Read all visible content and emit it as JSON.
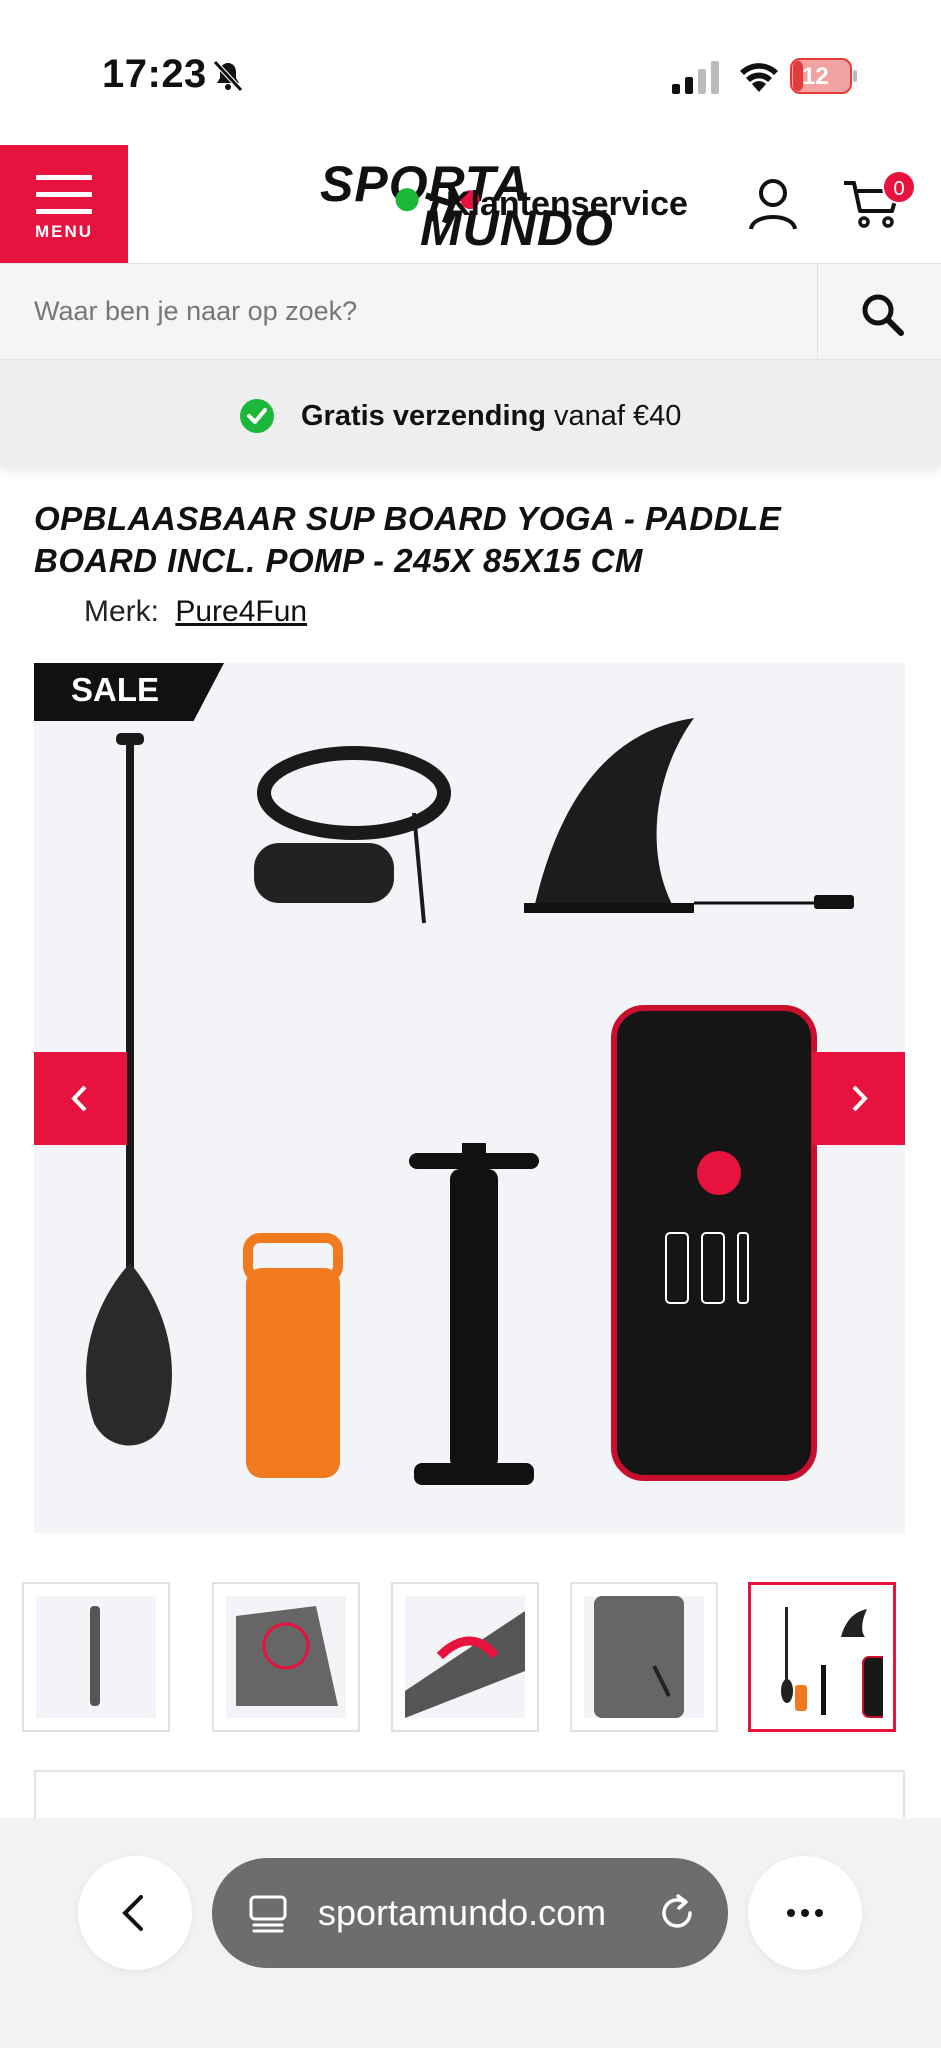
{
  "status": {
    "time": "17:23",
    "battery": "12"
  },
  "header": {
    "menu_label": "MENU",
    "logo_top": "SPORTA",
    "logo_bottom": "MUNDO",
    "service_label": "Klantenservice",
    "cart_count": "0"
  },
  "search": {
    "placeholder": "Waar ben je naar op zoek?"
  },
  "banner": {
    "bold": "Gratis verzending",
    "rest": "vanaf €40"
  },
  "product": {
    "title": "Opblaasbaar SUP Board Yoga - Paddle Board incl. pomp - 245x 85x15 cm",
    "brand_label": "Merk:",
    "brand_name": "Pure4Fun",
    "badge": "SALE",
    "thumbnails": 5,
    "active_thumbnail": 5
  },
  "browser": {
    "url": "sportamundo.com"
  },
  "colors": {
    "accent": "#e8123f",
    "check": "#1bb83a"
  }
}
